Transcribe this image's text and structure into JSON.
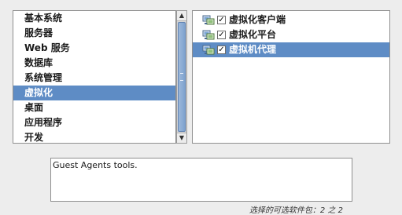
{
  "categories": {
    "items": [
      {
        "label": "基本系统",
        "selected": false
      },
      {
        "label": "服务器",
        "selected": false
      },
      {
        "label": "Web 服务",
        "selected": false
      },
      {
        "label": "数据库",
        "selected": false
      },
      {
        "label": "系统管理",
        "selected": false
      },
      {
        "label": "虚拟化",
        "selected": true
      },
      {
        "label": "桌面",
        "selected": false
      },
      {
        "label": "应用程序",
        "selected": false
      },
      {
        "label": "开发",
        "selected": false
      }
    ]
  },
  "packages": {
    "items": [
      {
        "label": "虚拟化客户端",
        "checked": true,
        "selected": false,
        "icon": "package-group-icon"
      },
      {
        "label": "虚拟化平台",
        "checked": true,
        "selected": false,
        "icon": "package-group-icon"
      },
      {
        "label": "虚拟机代理",
        "checked": true,
        "selected": true,
        "icon": "package-group-icon"
      }
    ]
  },
  "description": {
    "text": "Guest Agents tools."
  },
  "status": {
    "text": "选择的可选软件包：2 之 2"
  },
  "colors": {
    "selection": "#5e8cc5",
    "background": "#ededed"
  }
}
